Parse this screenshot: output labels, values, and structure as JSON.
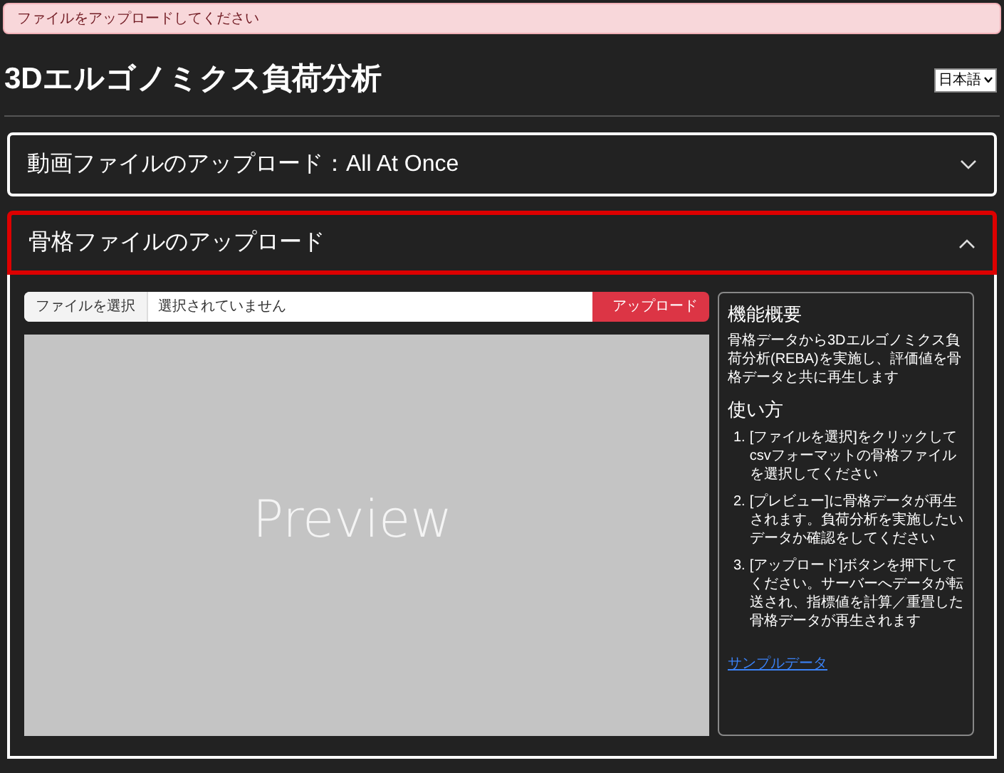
{
  "alert": {
    "text": "ファイルをアップロードしてください"
  },
  "header": {
    "title": "3Dエルゴノミクス負荷分析",
    "language": "日本語"
  },
  "accordions": [
    {
      "title": "動画ファイルのアップロード：All At Once",
      "expanded": false,
      "focused": false
    },
    {
      "title": "骨格ファイルのアップロード",
      "expanded": true,
      "focused": true
    }
  ],
  "upload": {
    "choose_button": "ファイルを選択",
    "file_status": "選択されていません",
    "upload_button": "アップロード"
  },
  "preview": {
    "label": "Preview"
  },
  "info": {
    "overview_title": "機能概要",
    "overview_text": "骨格データから3Dエルゴノミクス負荷分析(REBA)を実施し、評価値を骨格データと共に再生します",
    "usage_title": "使い方",
    "steps": [
      {
        "number": "1.",
        "text": "[ファイルを選択]をクリックしてcsvフォーマットの骨格ファイルを選択してください"
      },
      {
        "number": "2.",
        "text": "[プレビュー]に骨格データが再生されます。負荷分析を実施したいデータか確認をしてください"
      },
      {
        "number": "3.",
        "text": "[アップロード]ボタンを押下してください。サーバーへデータが転送され、指標値を計算／重畳した骨格データが再生されます"
      }
    ],
    "link": "サンプルデータ"
  }
}
